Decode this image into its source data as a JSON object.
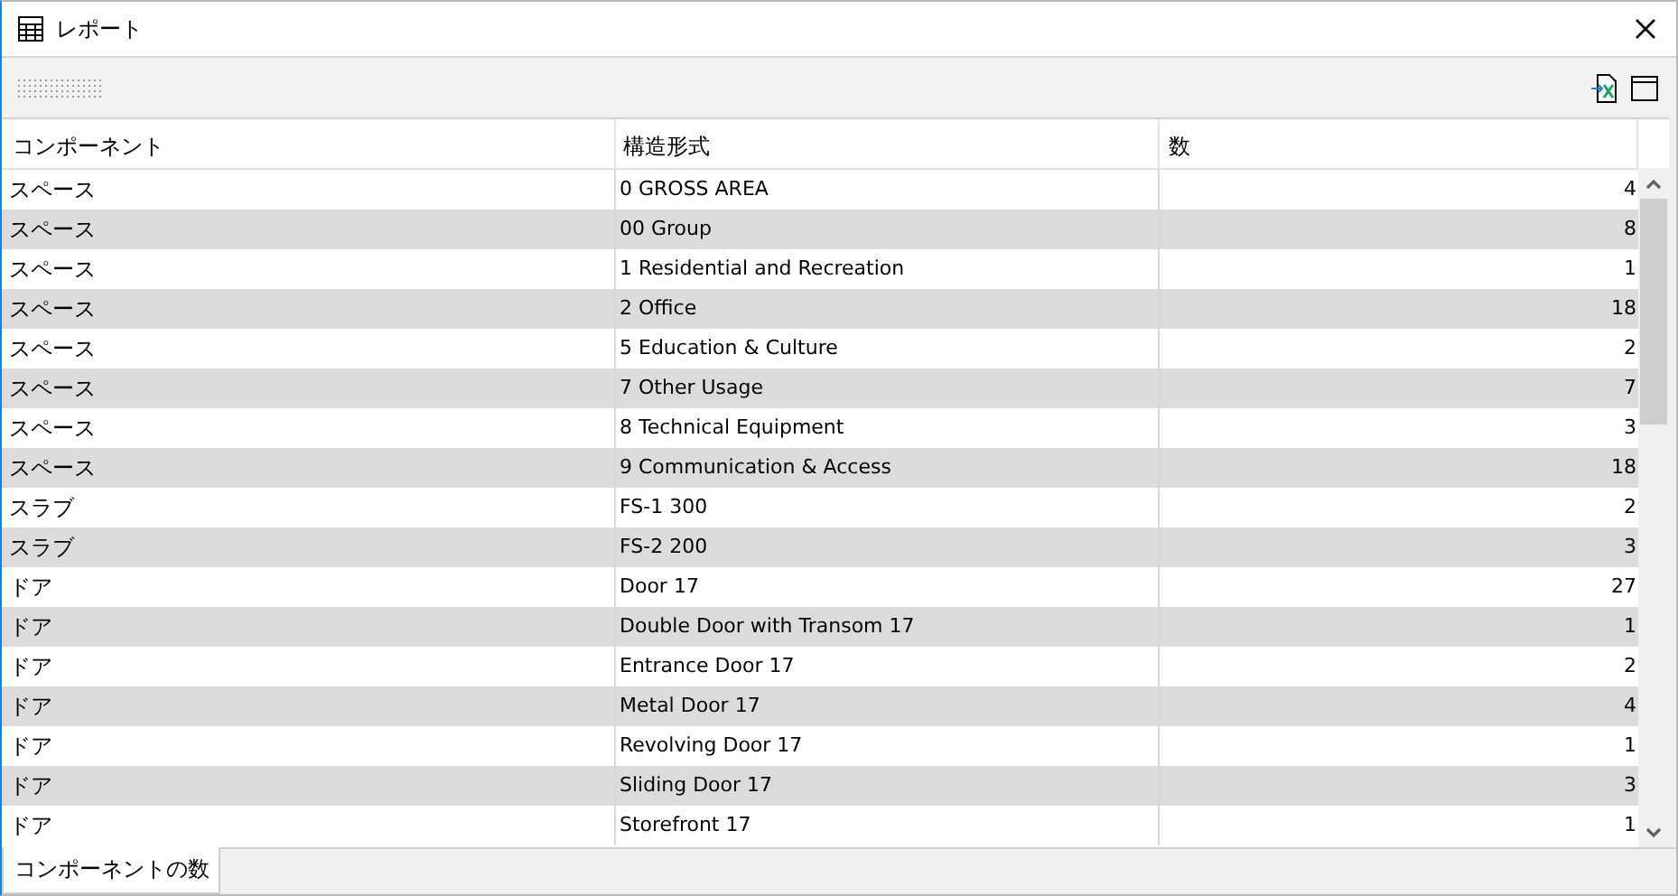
{
  "window": {
    "title": "レポート"
  },
  "table": {
    "columns": [
      "コンポーネント",
      "構造形式",
      "数"
    ],
    "rows": [
      [
        "スペース",
        "0 GROSS AREA",
        "4"
      ],
      [
        "スペース",
        "00 Group",
        "8"
      ],
      [
        "スペース",
        "1 Residential and Recreation",
        "1"
      ],
      [
        "スペース",
        "2 Office",
        "18"
      ],
      [
        "スペース",
        "5 Education & Culture",
        "2"
      ],
      [
        "スペース",
        "7 Other Usage",
        "7"
      ],
      [
        "スペース",
        "8 Technical Equipment",
        "3"
      ],
      [
        "スペース",
        "9 Communication & Access",
        "18"
      ],
      [
        "スラブ",
        "FS-1 300",
        "2"
      ],
      [
        "スラブ",
        "FS-2 200",
        "3"
      ],
      [
        "ドア",
        "Door 17",
        "27"
      ],
      [
        "ドア",
        "Double Door with Transom 17",
        "1"
      ],
      [
        "ドア",
        "Entrance Door 17",
        "2"
      ],
      [
        "ドア",
        "Metal Door 17",
        "4"
      ],
      [
        "ドア",
        "Revolving Door 17",
        "1"
      ],
      [
        "ドア",
        "Sliding Door 17",
        "3"
      ],
      [
        "ドア",
        "Storefront 17",
        "1"
      ]
    ]
  },
  "tabs": [
    {
      "label": "コンポーネントの数",
      "selected": true
    }
  ]
}
